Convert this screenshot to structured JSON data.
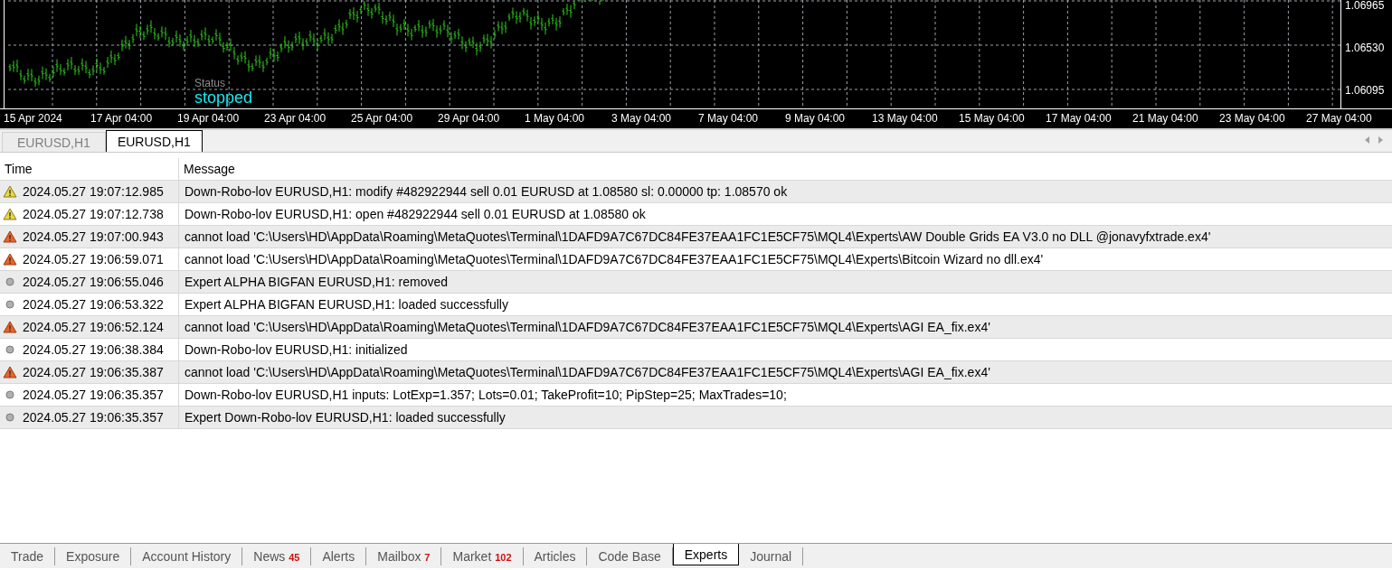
{
  "chart": {
    "price_labels": [
      "1.06965",
      "1.06530",
      "1.06095"
    ],
    "time_labels": [
      "15 Apr 2024",
      "17 Apr 04:00",
      "19 Apr 04:00",
      "23 Apr 04:00",
      "25 Apr 04:00",
      "29 Apr 04:00",
      "1 May 04:00",
      "3 May 04:00",
      "7 May 04:00",
      "9 May 04:00",
      "13 May 04:00",
      "15 May 04:00",
      "17 May 04:00",
      "21 May 04:00",
      "23 May 04:00",
      "27 May 04:00"
    ],
    "status_label": "Status",
    "status_value": "stopped"
  },
  "chart_tabs": [
    {
      "label": "EURUSD,H1",
      "selected": false
    },
    {
      "label": "EURUSD,H1",
      "selected": true
    }
  ],
  "log": {
    "columns": [
      "Time",
      "Message"
    ],
    "rows": [
      {
        "kind": "warning",
        "time": "2024.05.27 19:07:12.985",
        "message": "Down-Robo-lov EURUSD,H1: modify #482922944 sell 0.01 EURUSD at 1.08580 sl: 0.00000 tp: 1.08570 ok"
      },
      {
        "kind": "warning",
        "time": "2024.05.27 19:07:12.738",
        "message": "Down-Robo-lov EURUSD,H1: open #482922944 sell 0.01 EURUSD at 1.08580 ok"
      },
      {
        "kind": "error",
        "time": "2024.05.27 19:07:00.943",
        "message": "cannot load 'C:\\Users\\HD\\AppData\\Roaming\\MetaQuotes\\Terminal\\1DAFD9A7C67DC84FE37EAA1FC1E5CF75\\MQL4\\Experts\\AW Double Grids EA V3.0 no DLL @jonavyfxtrade.ex4'"
      },
      {
        "kind": "error",
        "time": "2024.05.27 19:06:59.071",
        "message": "cannot load 'C:\\Users\\HD\\AppData\\Roaming\\MetaQuotes\\Terminal\\1DAFD9A7C67DC84FE37EAA1FC1E5CF75\\MQL4\\Experts\\Bitcoin Wizard no dll.ex4'"
      },
      {
        "kind": "info",
        "time": "2024.05.27 19:06:55.046",
        "message": "Expert ALPHA BIGFAN EURUSD,H1: removed"
      },
      {
        "kind": "info",
        "time": "2024.05.27 19:06:53.322",
        "message": "Expert ALPHA BIGFAN EURUSD,H1: loaded successfully"
      },
      {
        "kind": "error",
        "time": "2024.05.27 19:06:52.124",
        "message": "cannot load 'C:\\Users\\HD\\AppData\\Roaming\\MetaQuotes\\Terminal\\1DAFD9A7C67DC84FE37EAA1FC1E5CF75\\MQL4\\Experts\\AGI EA_fix.ex4'"
      },
      {
        "kind": "info",
        "time": "2024.05.27 19:06:38.384",
        "message": "Down-Robo-lov EURUSD,H1: initialized"
      },
      {
        "kind": "error",
        "time": "2024.05.27 19:06:35.387",
        "message": "cannot load 'C:\\Users\\HD\\AppData\\Roaming\\MetaQuotes\\Terminal\\1DAFD9A7C67DC84FE37EAA1FC1E5CF75\\MQL4\\Experts\\AGI EA_fix.ex4'"
      },
      {
        "kind": "info",
        "time": "2024.05.27 19:06:35.357",
        "message": "Down-Robo-lov EURUSD,H1 inputs: LotExp=1.357; Lots=0.01; TakeProfit=10; PipStep=25; MaxTrades=10;"
      },
      {
        "kind": "info",
        "time": "2024.05.27 19:06:35.357",
        "message": "Expert Down-Robo-lov EURUSD,H1: loaded successfully"
      }
    ]
  },
  "terminal_tabs": [
    {
      "label": "Trade",
      "selected": false
    },
    {
      "label": "Exposure",
      "selected": false
    },
    {
      "label": "Account History",
      "selected": false
    },
    {
      "label": "News",
      "count": "45",
      "selected": false
    },
    {
      "label": "Alerts",
      "selected": false
    },
    {
      "label": "Mailbox",
      "count": "7",
      "selected": false
    },
    {
      "label": "Market",
      "count": "102",
      "selected": false
    },
    {
      "label": "Articles",
      "selected": false
    },
    {
      "label": "Code Base",
      "selected": false
    },
    {
      "label": "Experts",
      "selected": true
    },
    {
      "label": "Journal",
      "selected": false
    }
  ]
}
